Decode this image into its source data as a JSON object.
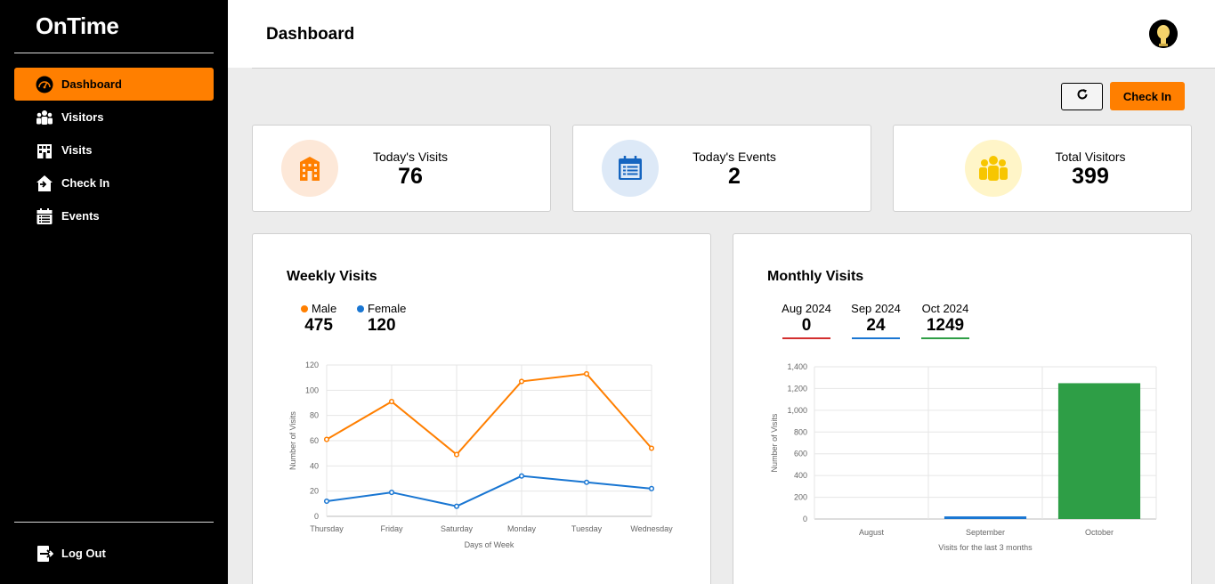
{
  "app": {
    "name": "OnTime"
  },
  "sidebar": {
    "items": [
      {
        "label": "Dashboard",
        "icon": "dashboard-gauge-icon",
        "active": true
      },
      {
        "label": "Visitors",
        "icon": "users-icon",
        "active": false
      },
      {
        "label": "Visits",
        "icon": "building-icon",
        "active": false
      },
      {
        "label": "Check In",
        "icon": "house-enter-icon",
        "active": false
      },
      {
        "label": "Events",
        "icon": "calendar-list-icon",
        "active": false
      }
    ],
    "logout_label": "Log Out"
  },
  "header": {
    "title": "Dashboard"
  },
  "toolbar": {
    "refresh_icon": "refresh-icon",
    "checkin_label": "Check In"
  },
  "stats": [
    {
      "label": "Today's Visits",
      "value": "76",
      "icon": "building-icon",
      "color": "#ff7f00",
      "bg": "#fde8d8"
    },
    {
      "label": "Today's Events",
      "value": "2",
      "icon": "calendar-list-icon",
      "color": "#1565c0",
      "bg": "#dde9f7"
    },
    {
      "label": "Total Visitors",
      "value": "399",
      "icon": "users-icon",
      "color": "#f7c600",
      "bg": "#fff5c8"
    }
  ],
  "weekly": {
    "title": "Weekly Visits",
    "legend": [
      {
        "name": "Male",
        "total": "475",
        "color": "#ff7f00"
      },
      {
        "name": "Female",
        "total": "120",
        "color": "#1976d2"
      }
    ]
  },
  "monthly": {
    "title": "Monthly Visits",
    "months": [
      {
        "label": "Aug 2024",
        "value": "0",
        "color": "#d32f2f"
      },
      {
        "label": "Sep 2024",
        "value": "24",
        "color": "#1976d2"
      },
      {
        "label": "Oct 2024",
        "value": "1249",
        "color": "#2e9e46"
      }
    ]
  },
  "chart_data": [
    {
      "type": "line",
      "title": "Weekly Visits",
      "categories": [
        "Thursday",
        "Friday",
        "Saturday",
        "Monday",
        "Tuesday",
        "Wednesday"
      ],
      "series": [
        {
          "name": "Male",
          "color": "#ff7f00",
          "values": [
            61,
            91,
            49,
            107,
            113,
            54
          ]
        },
        {
          "name": "Female",
          "color": "#1976d2",
          "values": [
            12,
            19,
            8,
            32,
            27,
            22
          ]
        }
      ],
      "xlabel": "Days of Week",
      "ylabel": "Number of Visits",
      "ylim": [
        0,
        120
      ],
      "yticks": [
        "0",
        "20",
        "40",
        "60",
        "80",
        "100",
        "120"
      ],
      "grid": true
    },
    {
      "type": "bar",
      "title": "Monthly Visits",
      "categories": [
        "August",
        "September",
        "October"
      ],
      "values": [
        0,
        24,
        1249
      ],
      "colors": [
        "#d32f2f",
        "#1976d2",
        "#2e9e46"
      ],
      "xlabel": "Visits for the last 3 months",
      "ylabel": "Number of Visits",
      "ylim": [
        0,
        1400
      ],
      "yticks": [
        "0",
        "200",
        "400",
        "600",
        "800",
        "1,000",
        "1,200",
        "1,400"
      ],
      "grid": true
    }
  ]
}
